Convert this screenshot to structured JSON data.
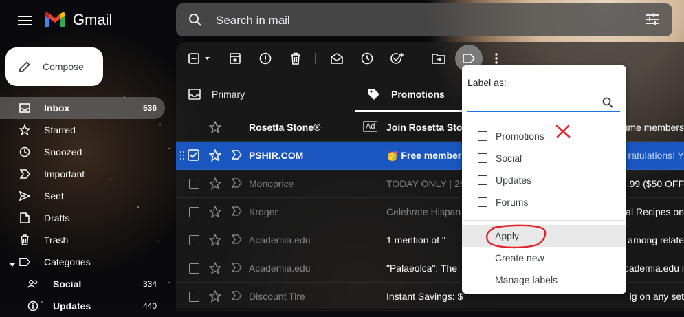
{
  "app": {
    "name": "Gmail"
  },
  "search": {
    "placeholder": "Search in mail"
  },
  "compose": {
    "label": "Compose"
  },
  "nav": [
    {
      "label": "Inbox",
      "count": "536",
      "icon": "inbox-icon"
    },
    {
      "label": "Starred",
      "count": "",
      "icon": "star-icon"
    },
    {
      "label": "Snoozed",
      "count": "",
      "icon": "clock-icon"
    },
    {
      "label": "Important",
      "count": "",
      "icon": "important-icon"
    },
    {
      "label": "Sent",
      "count": "",
      "icon": "send-icon"
    },
    {
      "label": "Drafts",
      "count": "",
      "icon": "draft-icon"
    },
    {
      "label": "Trash",
      "count": "",
      "icon": "trash-icon"
    },
    {
      "label": "Categories",
      "count": "",
      "icon": "label-icon"
    },
    {
      "label": "Social",
      "count": "334",
      "icon": "people-icon"
    },
    {
      "label": "Updates",
      "count": "440",
      "icon": "info-icon"
    }
  ],
  "tabs": [
    {
      "label": "Primary",
      "icon": "inbox-tab-icon"
    },
    {
      "label": "Promotions",
      "icon": "tag-icon"
    }
  ],
  "emails": [
    {
      "sender": "Rosetta Stone®",
      "ad": "Ad",
      "subject": "Join Rosetta Sto",
      "snippet": "time members"
    },
    {
      "sender": "PSHIR.COM",
      "subject": "🥳 Free member",
      "snippet": "ratulations! Y"
    },
    {
      "sender": "Monoprice",
      "subject": "TODAY ONLY | 25",
      "snippet": "9.99 ($50 OFF"
    },
    {
      "sender": "Kroger",
      "subject": "Celebrate Hispan",
      "snippet": "al Recipes on"
    },
    {
      "sender": "Academia.edu",
      "subject": "1 mention of \"",
      "snippet": "among relate"
    },
    {
      "sender": "Academia.edu",
      "subject": "\"Palaeolca\": The",
      "snippet": "cademia.edu i"
    },
    {
      "sender": "Discount Tire",
      "subject": "Instant Savings: $",
      "snippet": "ig on any set"
    }
  ],
  "label_menu": {
    "title": "Label as:",
    "options": [
      "Promotions",
      "Social",
      "Updates",
      "Forums"
    ],
    "actions": [
      "Apply",
      "Create new",
      "Manage labels"
    ]
  },
  "annotations": {
    "cross_color": "#e0242a",
    "circle_color": "#e0242a"
  }
}
